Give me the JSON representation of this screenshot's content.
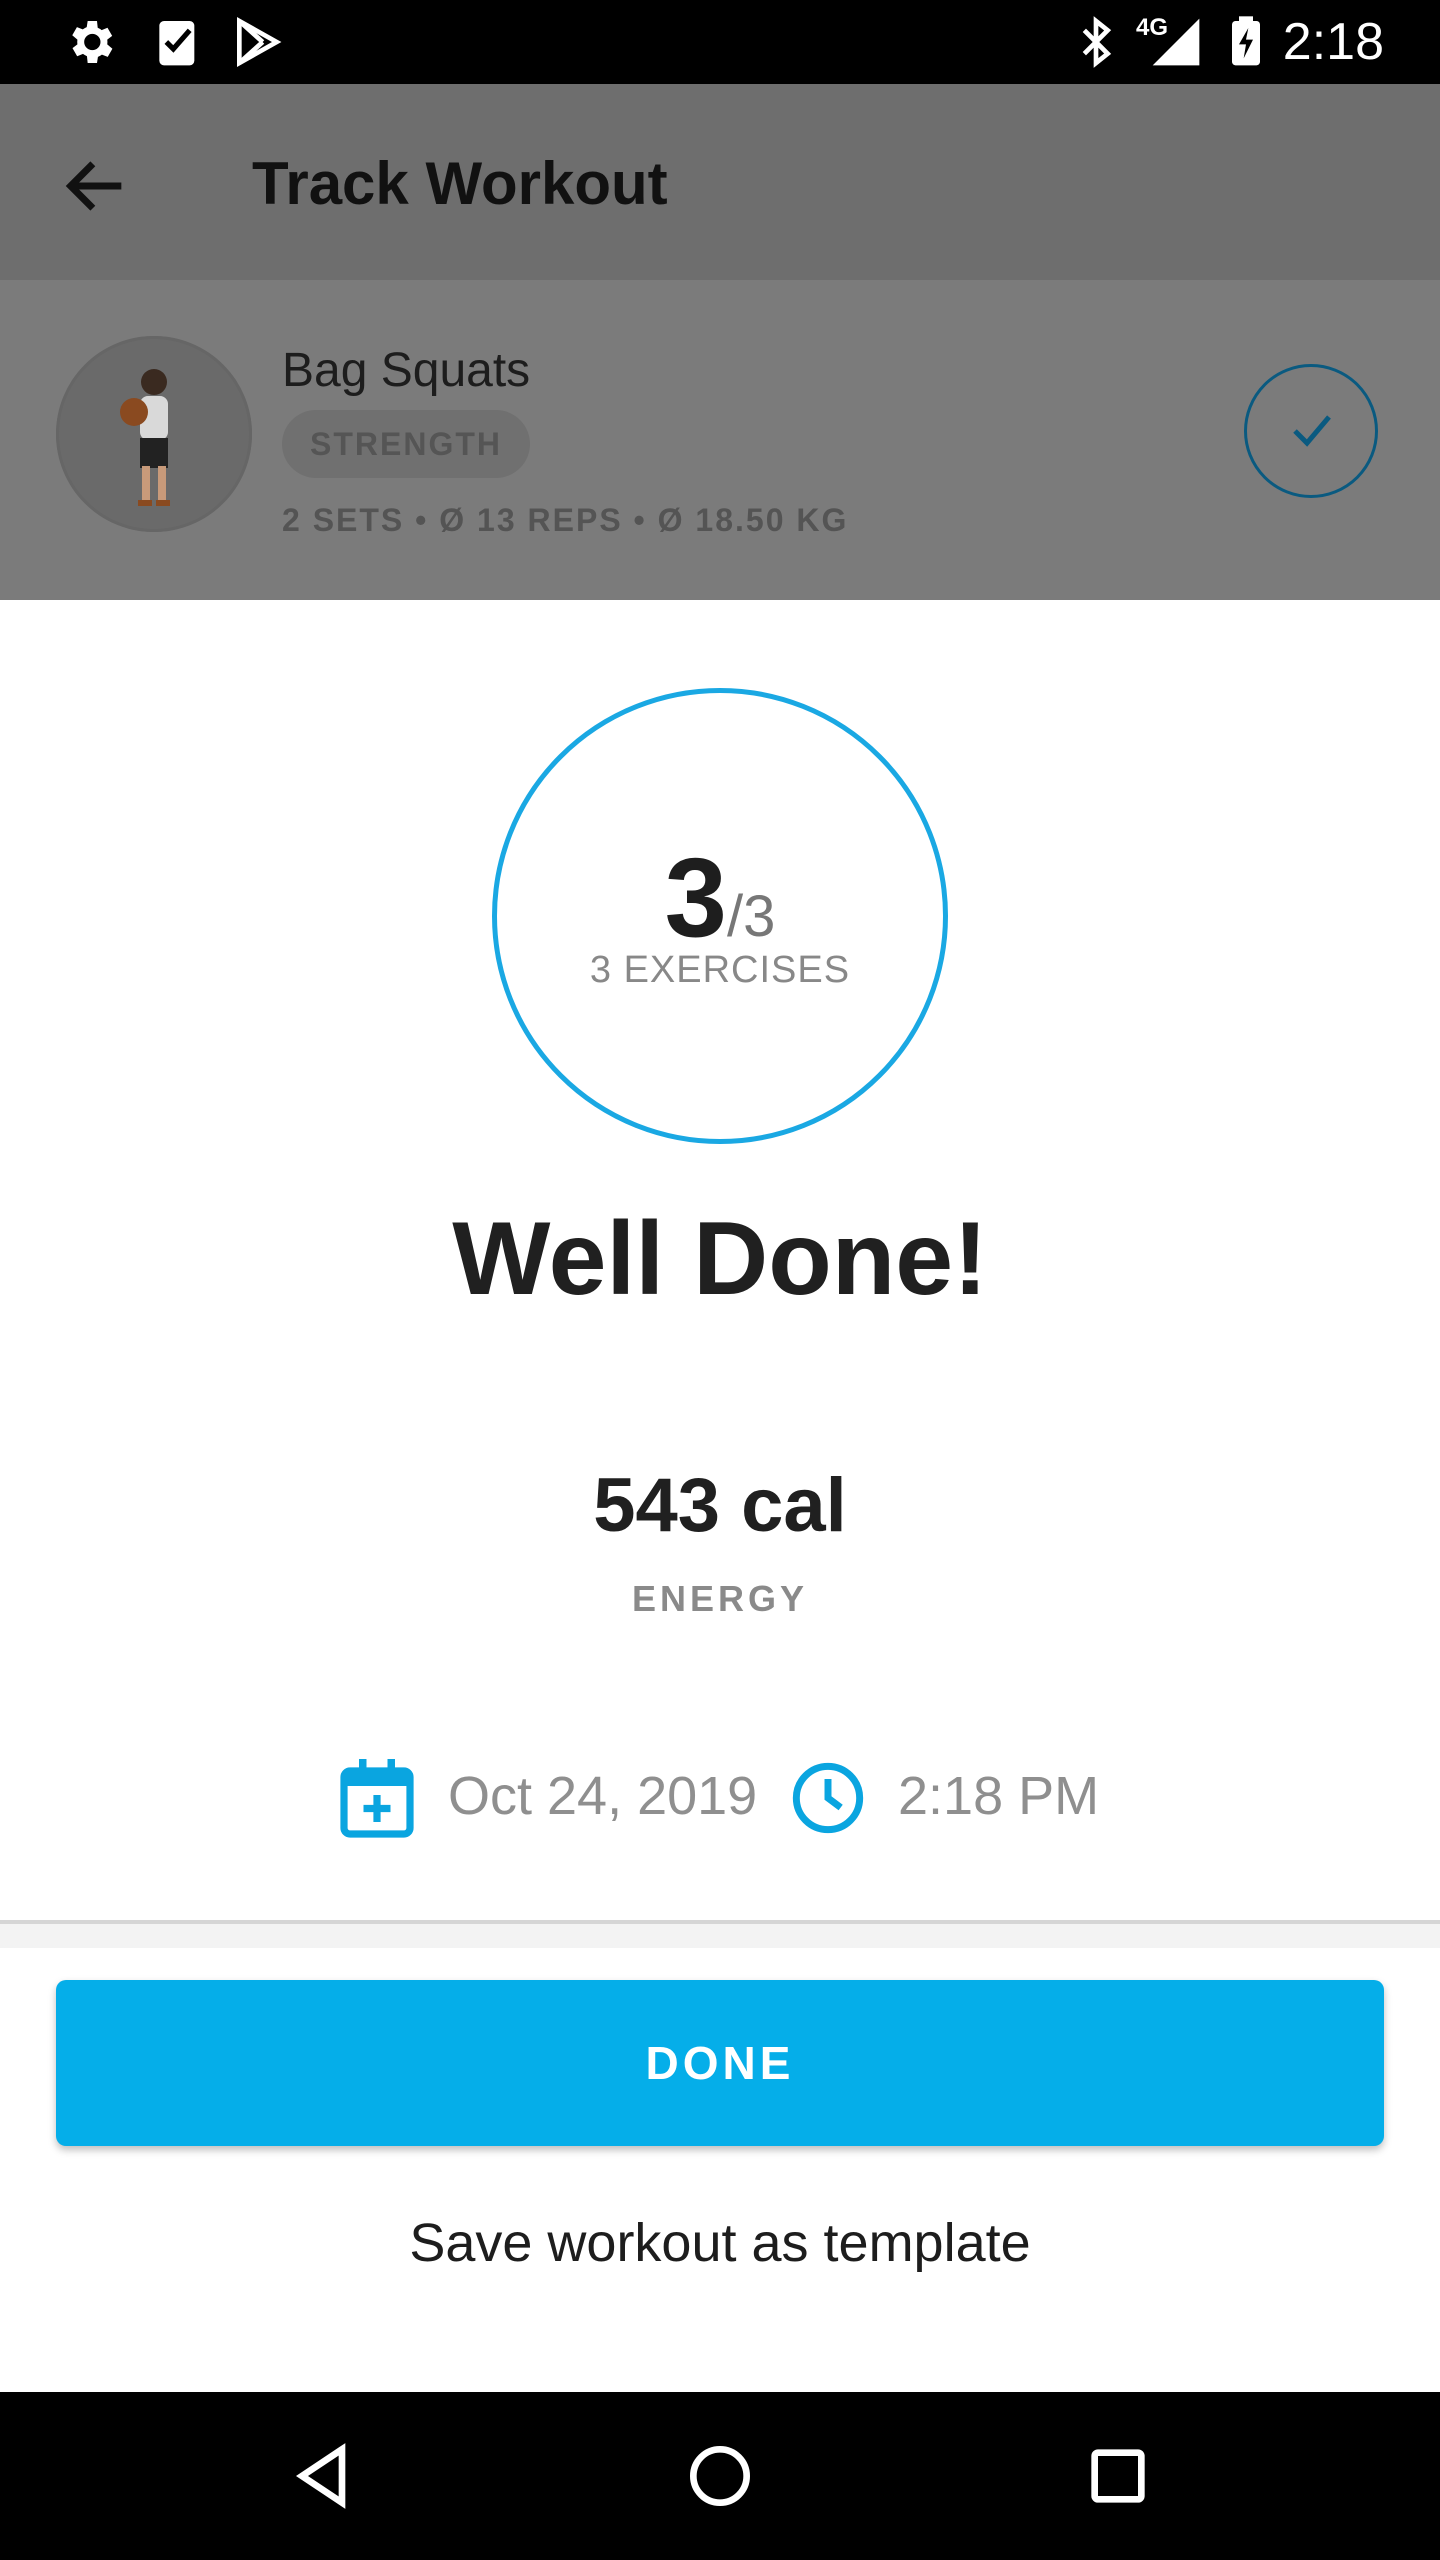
{
  "status_bar": {
    "time": "2:18",
    "network": "4G",
    "left_icons": [
      "settings-icon",
      "task-check-icon",
      "play-store-icon"
    ],
    "right_icons": [
      "bluetooth-icon",
      "signal-icon",
      "battery-charging-icon"
    ]
  },
  "app_bar": {
    "title": "Track Workout",
    "back_icon": "arrow-back-icon"
  },
  "exercise": {
    "name": "Bag Squats",
    "category": "STRENGTH",
    "stats": "2 SETS • Ø 13 REPS  • Ø 18.50 KG",
    "completed": true
  },
  "summary": {
    "completed_count": "3",
    "total_count": "/3",
    "exercises_label": "3 EXERCISES",
    "headline": "Well Done!",
    "energy_value": "543 cal",
    "energy_label": "ENERGY",
    "date": "Oct 24, 2019",
    "time": "2:18 PM"
  },
  "actions": {
    "done_label": "DONE",
    "save_template_label": "Save workout as template"
  },
  "colors": {
    "accent": "#05aee9",
    "ring": "#1aa8e3",
    "dim_overlay": "#6e6e6e"
  },
  "nav_bar": {
    "buttons": [
      "back-triangle-icon",
      "home-circle-icon",
      "recents-square-icon"
    ]
  }
}
